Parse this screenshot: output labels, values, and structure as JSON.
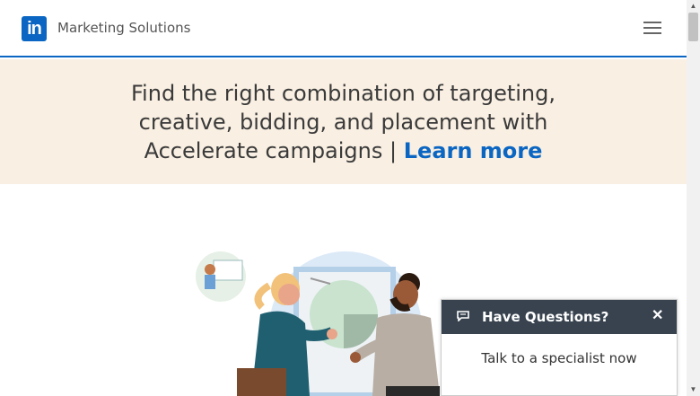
{
  "header": {
    "logo_text": "in",
    "brand": "Marketing Solutions",
    "menu_icon": "hamburger-menu-icon"
  },
  "banner": {
    "text": "Find the right combination of targeting, creative, bidding, and placement with Accelerate campaigns |",
    "link_label": "Learn more"
  },
  "chat": {
    "title": "Have Questions?",
    "close_label": "✕",
    "body": "Talk to a specialist now",
    "icon": "chat-icon"
  },
  "colors": {
    "brand_blue": "#0a66c2",
    "banner_bg": "#f9efe2",
    "chat_header": "#38434f"
  }
}
